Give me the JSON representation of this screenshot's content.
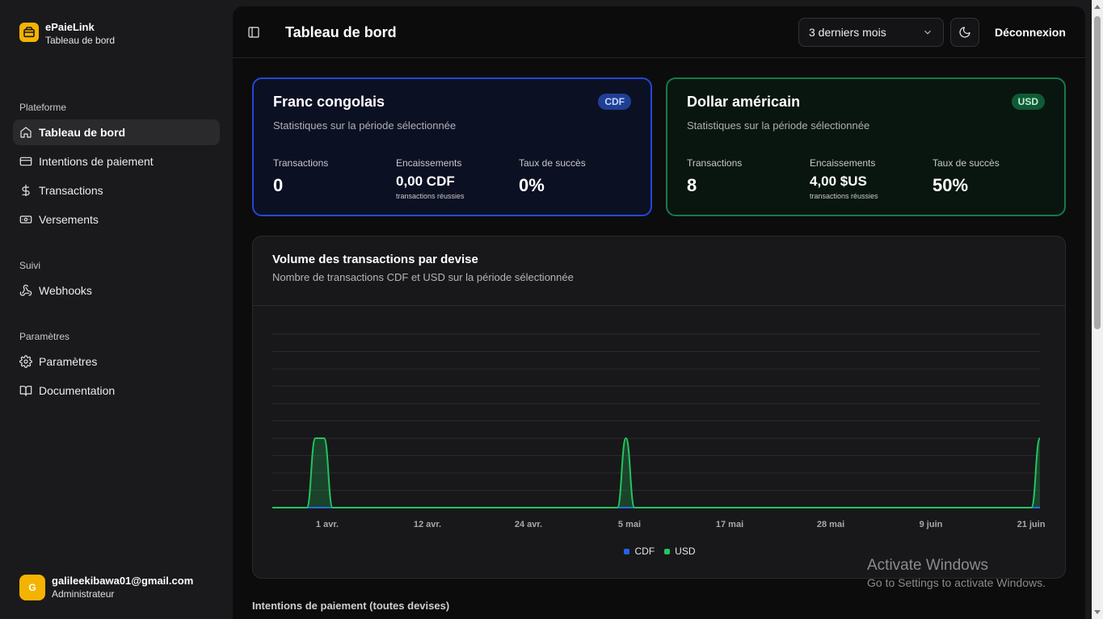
{
  "sidebar": {
    "brand": {
      "name": "ePaieLink",
      "subtitle": "Tableau de bord"
    },
    "sections": [
      {
        "label": "Plateforme"
      },
      {
        "label": "Suivi"
      },
      {
        "label": "Paramètres"
      }
    ],
    "items": [
      {
        "label": "Tableau de bord",
        "icon": "home-icon",
        "active": true
      },
      {
        "label": "Intentions de paiement",
        "icon": "credit-card-icon"
      },
      {
        "label": "Transactions",
        "icon": "dollar-icon"
      },
      {
        "label": "Versements",
        "icon": "banknote-icon"
      },
      {
        "label": "Webhooks",
        "icon": "webhook-icon"
      },
      {
        "label": "Paramètres",
        "icon": "gear-icon"
      },
      {
        "label": "Documentation",
        "icon": "book-icon"
      }
    ],
    "user": {
      "initial": "G",
      "email": "galileekibawa01@gmail.com",
      "role": "Administrateur"
    }
  },
  "header": {
    "title": "Tableau de bord",
    "period": "3 derniers mois",
    "logout": "Déconnexion"
  },
  "cards": {
    "cdf": {
      "title": "Franc congolais",
      "badge": "CDF",
      "subtitle": "Statistiques sur la période sélectionnée",
      "transactions_label": "Transactions",
      "transactions_value": "0",
      "collections_label": "Encaissements",
      "collections_value": "0,00 CDF",
      "collections_note": "transactions réussies",
      "success_label": "Taux de succès",
      "success_value": "0%",
      "accent": "#2547d8"
    },
    "usd": {
      "title": "Dollar américain",
      "badge": "USD",
      "subtitle": "Statistiques sur la période sélectionnée",
      "transactions_label": "Transactions",
      "transactions_value": "8",
      "collections_label": "Encaissements",
      "collections_value": "4,00 $US",
      "collections_note": "transactions réussies",
      "success_label": "Taux de succès",
      "success_value": "50%",
      "accent": "#167a4a"
    }
  },
  "chart": {
    "title": "Volume des transactions par devise",
    "subtitle": "Nombre de transactions CDF et USD sur la période sélectionnée"
  },
  "chart_data": {
    "type": "area",
    "x_tick_labels": [
      "1 avr.",
      "12 avr.",
      "24 avr.",
      "5 mai",
      "17 mai",
      "28 mai",
      "9 juin",
      "21 juin"
    ],
    "x_range": [
      "2025-03-24",
      "2025-06-21"
    ],
    "ylim": [
      0,
      5
    ],
    "grid": true,
    "legend_position": "bottom-center",
    "series": [
      {
        "name": "CDF",
        "color": "#2563eb",
        "points": []
      },
      {
        "name": "USD",
        "color": "#22c55e",
        "points": [
          {
            "x": "2025-03-29",
            "y": 2
          },
          {
            "x": "2025-03-30",
            "y": 2
          },
          {
            "x": "2025-05-04",
            "y": 2
          },
          {
            "x": "2025-06-21",
            "y": 2
          }
        ]
      }
    ]
  },
  "bottom_section_title": "Intentions de paiement (toutes devises)",
  "watermark": {
    "title": "Activate Windows",
    "subtitle": "Go to Settings to activate Windows."
  }
}
